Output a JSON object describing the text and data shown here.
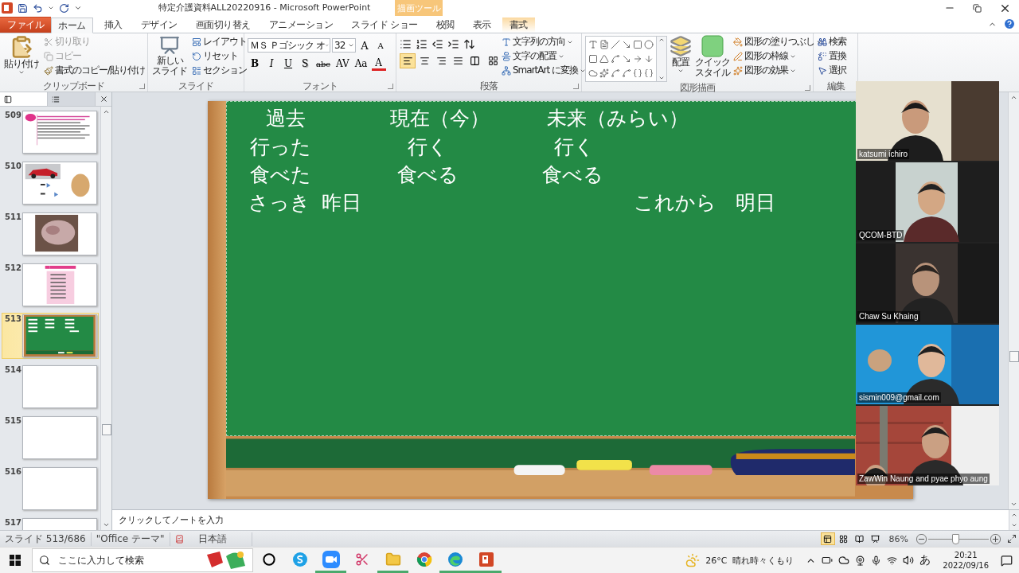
{
  "title_bar": {
    "title": "特定介護資料ALL20220916  -  Microsoft PowerPoint",
    "contextual_group": "描画ツール"
  },
  "tabs": [
    {
      "label": "ファイル",
      "kind": "file",
      "selected": false
    },
    {
      "label": "ホーム",
      "kind": "normal",
      "selected": true
    },
    {
      "label": "挿入",
      "kind": "normal",
      "selected": false
    },
    {
      "label": "デザイン",
      "kind": "normal",
      "selected": false
    },
    {
      "label": "画面切り替え",
      "kind": "normal",
      "selected": false
    },
    {
      "label": "アニメーション",
      "kind": "normal",
      "selected": false
    },
    {
      "label": "スライド ショー",
      "kind": "normal",
      "selected": false
    },
    {
      "label": "校閲",
      "kind": "normal",
      "selected": false
    },
    {
      "label": "表示",
      "kind": "normal",
      "selected": false
    },
    {
      "label": "書式",
      "kind": "contextual",
      "selected": false
    }
  ],
  "ribbon": {
    "clipboard": {
      "paste": "貼り付け",
      "items": [
        {
          "label": "切り取り",
          "disabled": true
        },
        {
          "label": "コピー",
          "disabled": true
        },
        {
          "label": "書式のコピー/貼り付け",
          "disabled": false
        }
      ],
      "group_label": "クリップボード"
    },
    "slides": {
      "new_slide": [
        "新しい",
        "スライド"
      ],
      "items": [
        "レイアウト",
        "リセット",
        "セクション"
      ],
      "group_label": "スライド"
    },
    "font": {
      "font_name": "ＭＳ Ｐゴシック オ",
      "font_size": "32",
      "size_buttons": [
        "A",
        "A"
      ],
      "format_buttons": [
        "B",
        "I",
        "U",
        "S",
        "abc",
        "AV",
        "Aa",
        "A"
      ],
      "group_label": "フォント"
    },
    "paragraph": {
      "alignments": [
        {
          "selected": true
        },
        {
          "selected": false
        },
        {
          "selected": false
        },
        {
          "selected": false
        },
        {
          "selected": false
        }
      ],
      "items": [
        "文字列の方向",
        "文字の配置",
        "SmartArt に変換"
      ],
      "group_label": "段落"
    },
    "drawing": {
      "arrange": "配置",
      "quick_style": [
        "クイック",
        "スタイル"
      ],
      "items": [
        "図形の塗りつぶし",
        "図形の枠線",
        "図形の効果"
      ],
      "group_label": "図形描画"
    },
    "editing": {
      "items": [
        "検索",
        "置換",
        "選択"
      ],
      "group_label": "編集"
    }
  },
  "slide_panel": {
    "thumbnails": [
      {
        "number": "509",
        "kind": "text",
        "selected": false
      },
      {
        "number": "510",
        "kind": "car",
        "selected": false
      },
      {
        "number": "511",
        "selected": false
      },
      {
        "number": "512",
        "kind": "list",
        "selected": false
      },
      {
        "number": "513",
        "kind": "board",
        "selected": true
      },
      {
        "number": "514",
        "kind": "blank",
        "selected": false
      },
      {
        "number": "515",
        "kind": "blank",
        "selected": false
      },
      {
        "number": "516",
        "kind": "blank",
        "selected": false
      },
      {
        "number": "517",
        "kind": "blank",
        "selected": false
      }
    ]
  },
  "slide": {
    "rows": [
      [
        "過去",
        "現在（今）",
        "未来（みらい）"
      ],
      [
        "行った",
        "行く",
        "行く"
      ],
      [
        "食べた",
        "食べる",
        "食べる"
      ],
      [
        "さっき",
        "昨日",
        "これから",
        "明日"
      ]
    ]
  },
  "video_tiles": [
    {
      "name": "katsumi ichiro"
    },
    {
      "name": "QCOM-BTD"
    },
    {
      "name": "Chaw Su Khaing"
    },
    {
      "name": "sismin009@gmail.com"
    },
    {
      "name": "ZawWin Naung and pyae phyo aung"
    }
  ],
  "notes": {
    "placeholder": "クリックしてノートを入力"
  },
  "status_bar": {
    "slide": "スライド 513/686",
    "theme": "\"Office テーマ\"",
    "language": "日本語",
    "views": [
      {
        "selected": true
      },
      {
        "selected": false
      },
      {
        "selected": false
      },
      {
        "selected": false
      }
    ],
    "zoom": "86%",
    "zoom_slider": {
      "level": 0.45
    }
  },
  "taskbar": {
    "search_placeholder": "ここに入力して検索",
    "apps": [
      {
        "kind": "cortana",
        "running": false
      },
      {
        "kind": "skype",
        "running": false
      },
      {
        "kind": "zoom",
        "running": true
      },
      {
        "kind": "snip",
        "running": false
      },
      {
        "kind": "explorer",
        "running": true
      },
      {
        "kind": "chrome",
        "running": false
      },
      {
        "kind": "edge",
        "running": true
      },
      {
        "kind": "powerpoint",
        "running": true
      }
    ],
    "temperature": "26°C",
    "weather": "晴れ時々くもり",
    "ime": "あ",
    "time": "20:21",
    "date": "2022/09/16"
  }
}
